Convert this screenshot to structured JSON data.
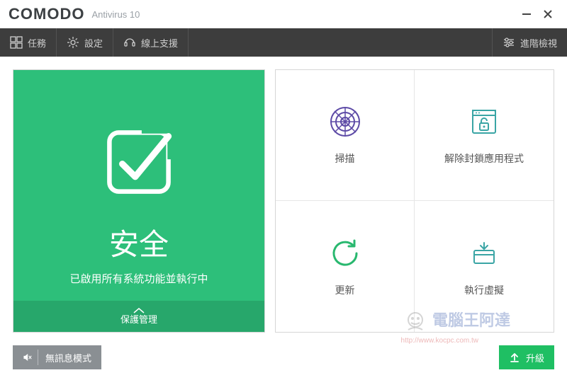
{
  "titlebar": {
    "brand": "COMODO",
    "product": "Antivirus 10"
  },
  "toolbar": {
    "tasks": "任務",
    "settings": "設定",
    "support": "線上支援",
    "advanced_view": "進階檢視"
  },
  "status": {
    "title": "安全",
    "subtitle": "已啟用所有系統功能並執行中",
    "footer_label": "保護管理"
  },
  "tiles": {
    "scan": "掃描",
    "unblock": "解除封鎖應用程式",
    "update": "更新",
    "virtual": "執行虛擬"
  },
  "bottom": {
    "silent_mode": "無訊息模式",
    "upgrade": "升級"
  },
  "watermark": {
    "text": "電腦王阿達",
    "url": "http://www.kocpc.com.tw"
  },
  "colors": {
    "accent_green": "#2dbf7a",
    "toolbar_bg": "#3d3d3d",
    "tile_icon_green": "#29b86f",
    "tile_icon_purple": "#5d4aa6",
    "tile_icon_teal": "#3aa5a5"
  }
}
